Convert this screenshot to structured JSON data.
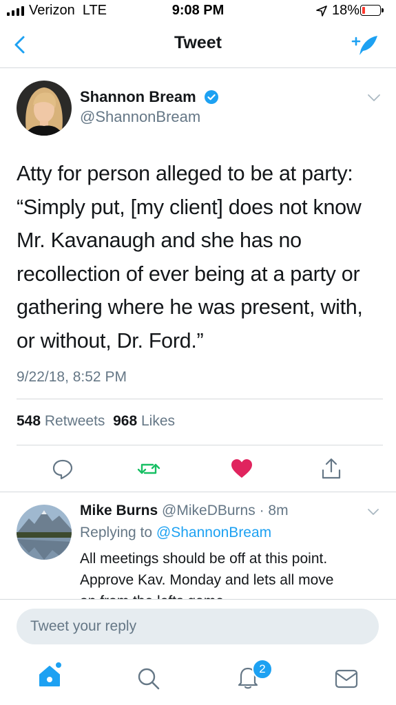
{
  "status_bar": {
    "carrier": "Verizon  LTE",
    "time": "9:08 PM",
    "battery_percent": "18%",
    "battery_level": 0.18,
    "icons": [
      "signal-icon",
      "location-arrow-icon",
      "battery-icon"
    ]
  },
  "nav": {
    "title": "Tweet",
    "back_icon": "chevron-left-icon",
    "compose_icon": "compose-tweet-icon"
  },
  "tweet": {
    "author_name": "Shannon Bream",
    "verified": true,
    "author_handle": "@ShannonBream",
    "text_lines": [
      "Atty for person alleged to be at party:",
      "“Simply put, [my client] does not know",
      "Mr. Kavanaugh and she has no",
      "recollection of ever being at a party or",
      "gathering where he was present, with,",
      "or without, Dr. Ford.”"
    ],
    "date": "9/22/18, 8:52 PM",
    "retweets_count": "548",
    "retweets_label": "Retweets",
    "likes_count": "968",
    "likes_label": "Likes",
    "actions": [
      "reply-icon",
      "retweet-icon",
      "like-icon",
      "share-icon"
    ]
  },
  "reply": {
    "author_name": "Mike Burns",
    "author_handle": "@MikeDBurns",
    "separator": " · ",
    "time": "8m",
    "replying_prefix": "Replying to ",
    "replying_to": "@ShannonBream",
    "text_lines": [
      "All meetings should be off at this point.",
      "Approve Kav. Monday and lets all move",
      "on from the lefts game"
    ]
  },
  "composer": {
    "placeholder": "Tweet your reply"
  },
  "tab_bar": {
    "items": [
      "home-icon",
      "search-icon",
      "notifications-icon",
      "messages-icon"
    ],
    "notifications_badge": "2"
  },
  "colors": {
    "accent": "#1da1f2",
    "retweet_green": "#17bf63",
    "like_red": "#e0245e",
    "secondary_text": "#657786"
  }
}
